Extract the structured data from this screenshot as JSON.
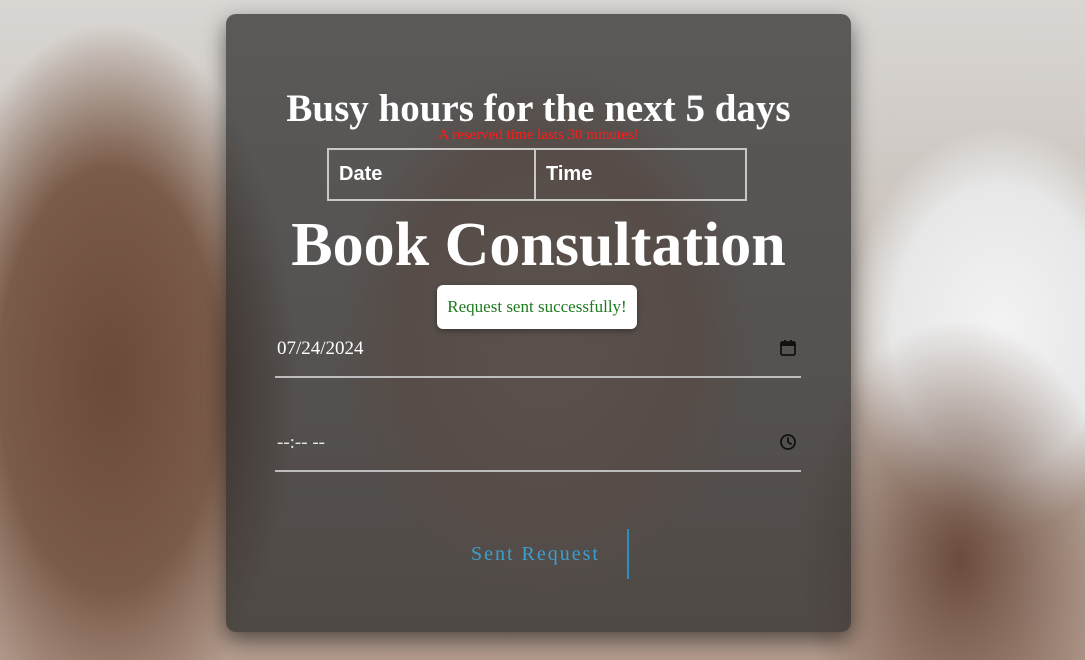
{
  "busy_section": {
    "title": "Busy hours for the next 5 days",
    "notice": "A reserved time lasts 30 minutes!",
    "table": {
      "headers": [
        "Date",
        "Time"
      ],
      "rows": []
    }
  },
  "booking": {
    "title": "Book Consultation",
    "toast": "Request sent successfully!",
    "date_value": "07/24/2024",
    "time_value": "--:-- --",
    "submit_label": "Sent Request"
  },
  "colors": {
    "notice": "#ff1a1a",
    "toast_text": "#1d7a1d",
    "button_accent": "#3a9fd0"
  },
  "icons": {
    "date_picker": "calendar-icon",
    "time_picker": "clock-icon"
  }
}
